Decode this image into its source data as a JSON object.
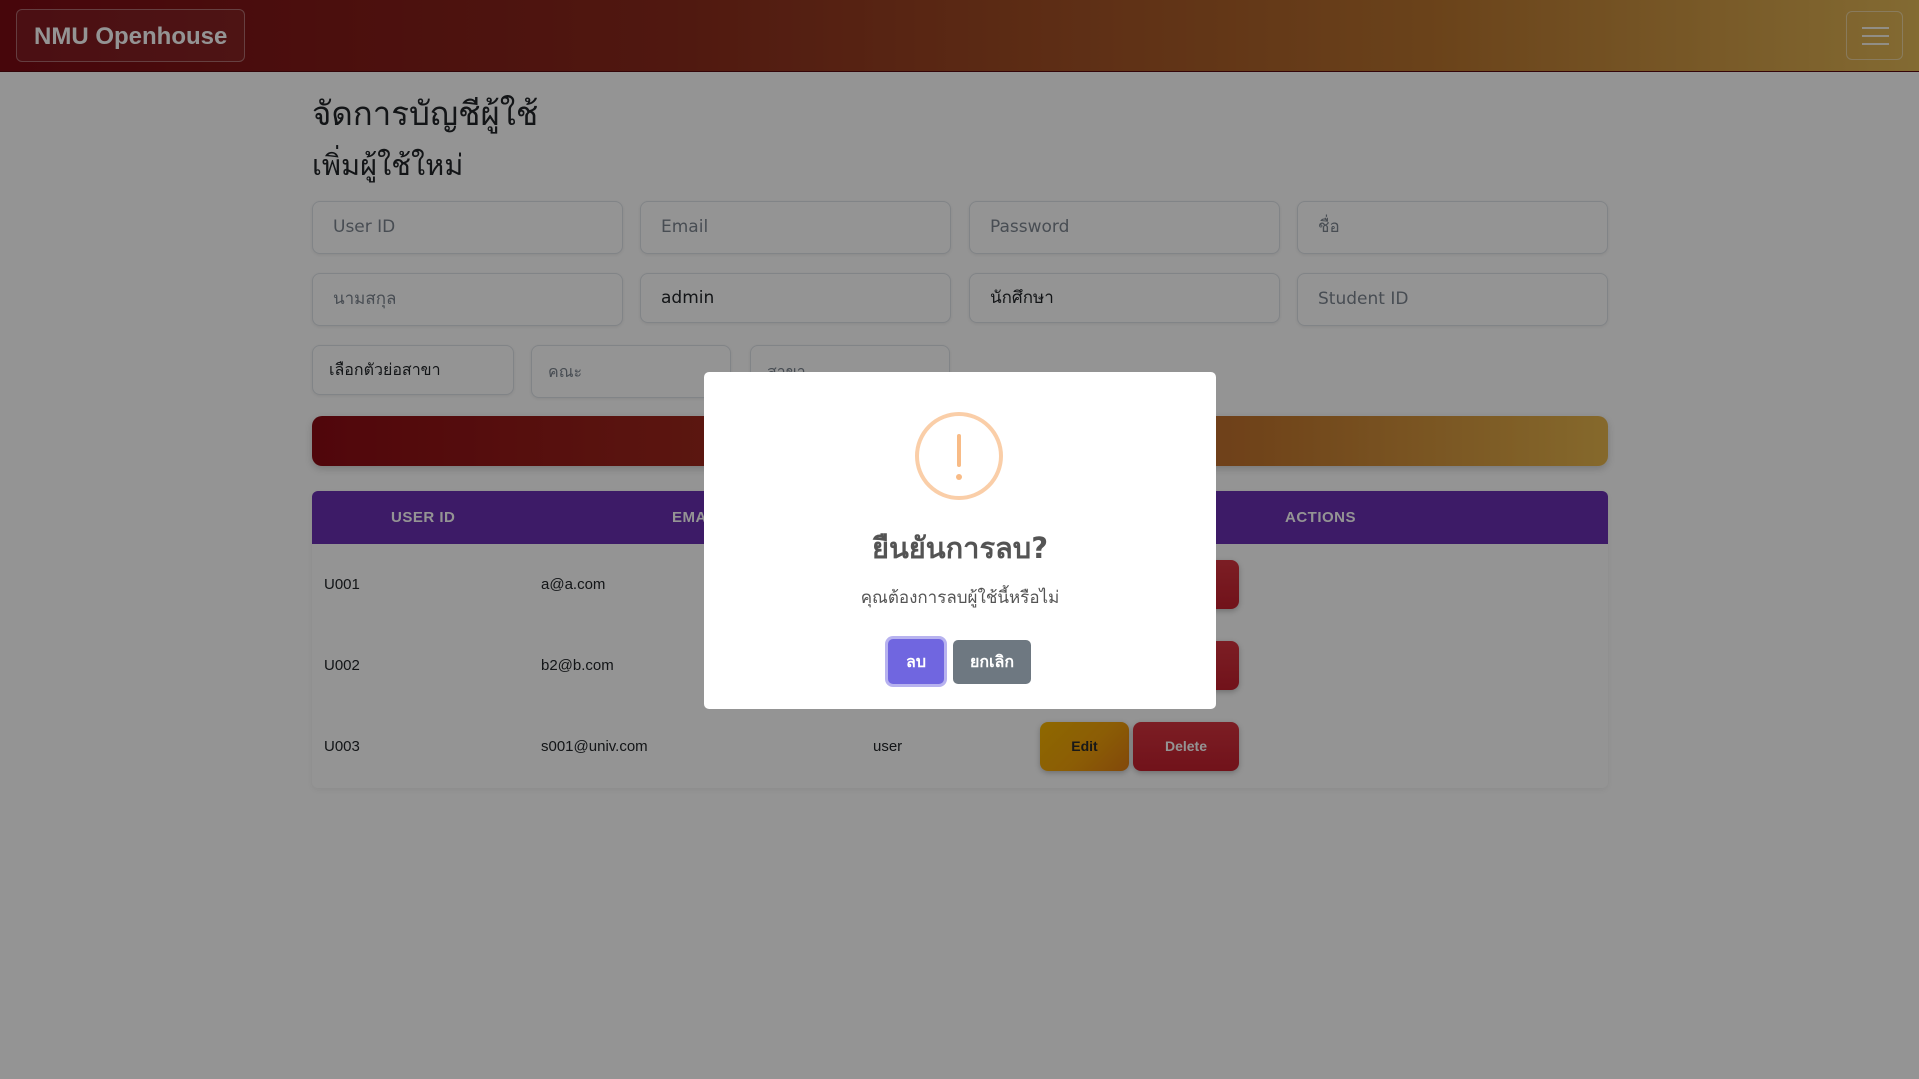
{
  "navbar": {
    "brand": "NMU Openhouse",
    "menu_icon": "hamburger-menu-icon"
  },
  "page": {
    "title": "จัดการบัญชีผู้ใช้",
    "section_title": "เพิ่มผู้ใช้ใหม่"
  },
  "form": {
    "user_id_placeholder": "User ID",
    "email_placeholder": "Email",
    "password_placeholder": "Password",
    "first_name_placeholder": "ชื่อ",
    "last_name_placeholder": "นามสกุล",
    "role_value": "admin",
    "type_value": "นักศึกษา",
    "student_id_placeholder": "Student ID",
    "branch_abbr_value": "เลือกตัวย่อสาขา",
    "faculty_placeholder": "คณะ",
    "branch_placeholder": "สาขา"
  },
  "table": {
    "headers": {
      "user_id": "USER ID",
      "email": "EMAIL",
      "actions": "ACTIONS"
    },
    "rows": [
      {
        "user_id": "U001",
        "email": "a@a.com",
        "role": ""
      },
      {
        "user_id": "U002",
        "email": "b2@b.com",
        "role": ""
      },
      {
        "user_id": "U003",
        "email": "s001@univ.com",
        "role": "user"
      }
    ],
    "edit_label": "Edit",
    "delete_label": "Delete"
  },
  "modal": {
    "icon": "warning-icon",
    "title": "ยืนยันการลบ?",
    "text": "คุณต้องการลบผู้ใช้นี้หรือไม่",
    "confirm_label": "ลบ",
    "cancel_label": "ยกเลิก"
  },
  "colors": {
    "table_header": "#6a2fb2",
    "confirm": "#7066e0",
    "cancel": "#6e7881",
    "delete": "#c3202e",
    "edit": "#f0a00a"
  }
}
